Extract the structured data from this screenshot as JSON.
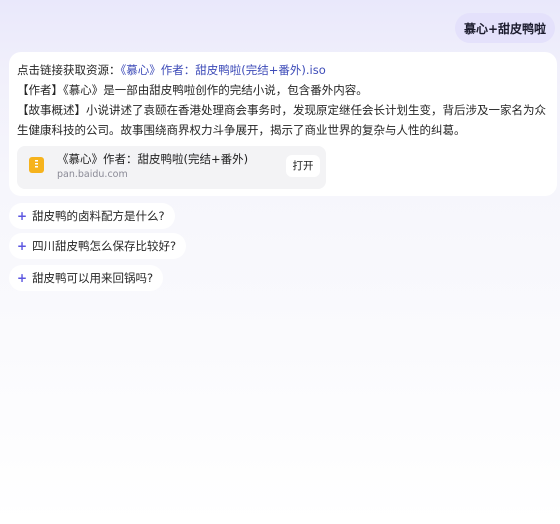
{
  "user_message": "慕心+甜皮鸭啦",
  "answer": {
    "line1_prefix": "点击链接获取资源：",
    "line1_link": "《慕心》作者：甜皮鸭啦(完结+番外).iso",
    "author_line": "【作者】《慕心》是一部由甜皮鸭啦创作的完结小说，包含番外内容。",
    "summary_line": "【故事概述】小说讲述了袁颐在香港处理商会事务时，发现原定继任会长计划生变，背后涉及一家名为众生健康科技的公司。故事围绕商界权力斗争展开，揭示了商业世界的复杂与人性的纠葛。"
  },
  "resource_card": {
    "icon": "document-icon",
    "title": "《慕心》作者：甜皮鸭啦(完结+番外)",
    "domain": "pan.baidu.com",
    "open_label": "打开"
  },
  "suggestions": [
    {
      "icon": "plus-icon",
      "text": "甜皮鸭的卤料配方是什么?"
    },
    {
      "icon": "plus-icon",
      "text": "四川甜皮鸭怎么保存比较好?"
    },
    {
      "icon": "plus-icon",
      "text": "甜皮鸭可以用来回锅吗?"
    }
  ],
  "colors": {
    "accent": "#5b55e0",
    "link": "#3d4bb8",
    "user_bubble": "#e4e1fb",
    "file_icon": "#f6b31d"
  }
}
